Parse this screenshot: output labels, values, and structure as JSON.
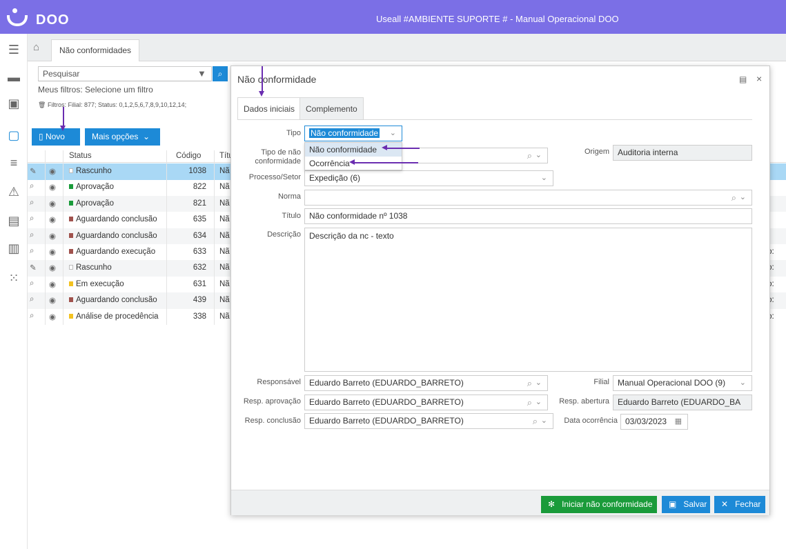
{
  "app": {
    "brand": "DOO",
    "title": "Useall #AMBIENTE SUPORTE # - Manual Operacional DOO"
  },
  "rail": {
    "icons": [
      "menu-icon",
      "folder-icon",
      "calendar-icon",
      "clipboard-icon",
      "list-icon",
      "warning-icon",
      "contact-icon",
      "chart-icon",
      "grid-icon"
    ]
  },
  "tabbar": {
    "home_icon": "home-icon",
    "tab_label": "Não conformidades"
  },
  "filters": {
    "search_placeholder": "Pesquisar",
    "my_filters_label": "Meus filtros:",
    "my_filters_value": "Selecione um filtro",
    "active_filters": "Filtros: Filial: 877; Status: 0,1,2,5,6,7,8,9,10,12,14;",
    "new_button": "Novo",
    "more_button": "Mais opções"
  },
  "table": {
    "headers": [
      "Status",
      "Código",
      "Títu"
    ],
    "rows": [
      {
        "status": "Rascunho",
        "color": "#ffffff",
        "code": "1038",
        "title": "Nã",
        "extra": "",
        "icon": "pencil"
      },
      {
        "status": "Aprovação",
        "color": "#1a9b3a",
        "code": "822",
        "title": "Nã",
        "extra": "",
        "icon": "search"
      },
      {
        "status": "Aprovação",
        "color": "#1a9b3a",
        "code": "821",
        "title": "Nã",
        "extra": "",
        "icon": "search"
      },
      {
        "status": "Aguardando conclusão",
        "color": "#a0524d",
        "code": "635",
        "title": "Nã",
        "extra": "",
        "icon": "search"
      },
      {
        "status": "Aguardando conclusão",
        "color": "#a0524d",
        "code": "634",
        "title": "Nã",
        "extra": "",
        "icon": "search"
      },
      {
        "status": "Aguardando execução",
        "color": "#a0524d",
        "code": "633",
        "title": "Nã",
        "extra": "ção:",
        "icon": "search"
      },
      {
        "status": "Rascunho",
        "color": "#ffffff",
        "code": "632",
        "title": "Nã",
        "extra": "ção:",
        "icon": "pencil"
      },
      {
        "status": "Em execução",
        "color": "#f3c221",
        "code": "631",
        "title": "Nã",
        "extra": "ção:",
        "icon": "search"
      },
      {
        "status": "Aguardando conclusão",
        "color": "#a0524d",
        "code": "439",
        "title": "Nã",
        "extra": "ção:",
        "icon": "search"
      },
      {
        "status": "Análise de procedência",
        "color": "#f3c221",
        "code": "338",
        "title": "Nã",
        "extra": "ção:",
        "icon": "search"
      }
    ]
  },
  "modal": {
    "title": "Não conformidade",
    "tabs": [
      "Dados iniciais",
      "Complemento"
    ],
    "fields": {
      "tipo_label": "Tipo",
      "tipo_value": "Não conformidade",
      "tipo_nc_label_1": "Tipo de não",
      "tipo_nc_label_2": "conformidade",
      "origem_label": "Origem",
      "origem_value": "Auditoria interna",
      "processo_label": "Processo/Setor",
      "processo_value": "Expedição (6)",
      "norma_label": "Norma",
      "norma_value": "",
      "titulo_label": "Título",
      "titulo_value": "Não conformidade nº 1038",
      "descricao_label": "Descrição",
      "descricao_value": "Descrição da nc - texto",
      "responsavel_label": "Responsável",
      "responsavel_value": "Eduardo Barreto  (EDUARDO_BARRETO)",
      "filial_label": "Filial",
      "filial_value": "Manual Operacional DOO (9)",
      "resp_aprovacao_label": "Resp. aprovação",
      "resp_aprovacao_value": "Eduardo Barreto  (EDUARDO_BARRETO)",
      "resp_abertura_label": "Resp. abertura",
      "resp_abertura_value": "Eduardo Barreto  (EDUARDO_BA",
      "resp_conclusao_label": "Resp. conclusão",
      "resp_conclusao_value": "Eduardo Barreto  (EDUARDO_BARRETO)",
      "data_label": "Data ocorrência",
      "data_value": "03/03/2023"
    },
    "tipo_options": [
      "Não conformidade",
      "Ocorrência"
    ],
    "buttons": {
      "iniciar": "Iniciar não conformidade",
      "salvar": "Salvar",
      "fechar": "Fechar"
    }
  },
  "colors": {
    "header": "#7b6fe6",
    "primary": "#1d8ad7",
    "success": "#1a9b3a",
    "annotation": "#6a2db0",
    "selected_row": "#a9d8f5"
  }
}
